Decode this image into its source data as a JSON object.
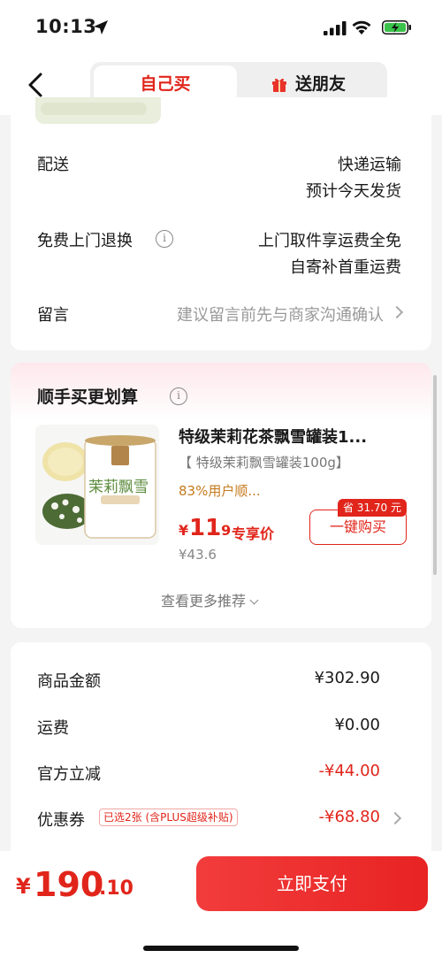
{
  "status_bar": {
    "time": "10:13"
  },
  "nav": {
    "tab_self": "自己买",
    "tab_gift": "送朋友"
  },
  "delivery": {
    "label": "配送",
    "method": "快递运输",
    "eta": "预计今天发货"
  },
  "return": {
    "label": "免费上门退换",
    "line1": "上门取件享运费全免",
    "line2": "自寄补首重运费"
  },
  "message": {
    "label": "留言",
    "placeholder": "建议留言前先与商家沟通确认"
  },
  "recommend": {
    "title": "顺手买更划算",
    "product": {
      "name": "特级茉莉花茶飘雪罐装1...",
      "spec": "【 特级茉莉飘雪罐装100g】",
      "rating": "83%用户顺...",
      "price_symbol": "¥",
      "price_int": "11",
      "price_dec": ".9",
      "price_tag": "专享价",
      "original_price": "¥43.6",
      "save_badge": "省 31.70 元",
      "buy_label": "一键购买",
      "can_label": "茉莉飘雪"
    },
    "more_label": "查看更多推荐"
  },
  "fees": {
    "goods_label": "商品金额",
    "goods_value": "¥302.90",
    "shipping_label": "运费",
    "shipping_value": "¥0.00",
    "discount_label": "官方立减",
    "discount_value": "-¥44.00",
    "coupon_label": "优惠券",
    "coupon_tag": "已选2张 (含PLUS超级补贴)",
    "coupon_value": "-¥68.80"
  },
  "footer": {
    "total_symbol": "¥",
    "total_int": "190",
    "total_dec": ".10",
    "pay_label": "立即支付"
  },
  "colors": {
    "accent": "#e1251b",
    "rating": "#c57a1c"
  }
}
